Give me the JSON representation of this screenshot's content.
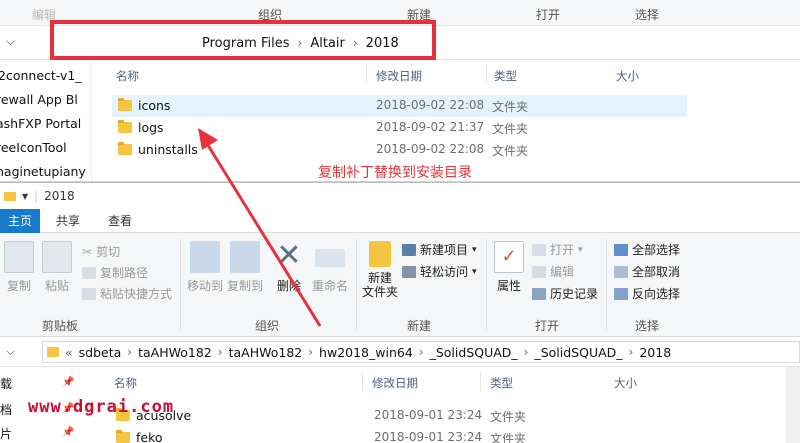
{
  "top_window": {
    "ribbon_labels": [
      "组织",
      "新建",
      "打开",
      "选择"
    ],
    "ribbon_label_partial": "编辑",
    "breadcrumb": [
      "Program Files",
      "Altair",
      "2018"
    ],
    "nav_pane_items": [
      "2connect-v1_",
      "rewall App Bl",
      "ashFXP Portal",
      "reeIconTool",
      "naginetupiany"
    ],
    "columns": {
      "name": "名称",
      "date": "修改日期",
      "type": "类型",
      "size": "大小"
    },
    "rows": [
      {
        "name": "icons",
        "date": "2018-09-02 22:08",
        "type": "文件夹",
        "selected": true
      },
      {
        "name": "logs",
        "date": "2018-09-02 21:37",
        "type": "文件夹",
        "selected": false
      },
      {
        "name": "uninstalls",
        "date": "2018-09-02 22:08",
        "type": "文件夹",
        "selected": false
      }
    ],
    "annotation": "复制补丁替换到安装目录"
  },
  "bottom_window": {
    "title": "2018",
    "tabs": [
      "主页",
      "共享",
      "查看"
    ],
    "ribbon": {
      "clipboard": {
        "copy": "复制",
        "paste": "粘贴",
        "cut": "剪切",
        "copy_path": "复制路径",
        "paste_shortcut": "粘贴快捷方式",
        "label": "剪贴板"
      },
      "organize": {
        "move_to": "移动到",
        "copy_to": "复制到",
        "delete": "删除",
        "rename": "重命名",
        "label": "组织"
      },
      "new": {
        "new_folder": "新建\n文件夹",
        "new_item": "新建项目",
        "easy_access": "轻松访问",
        "label": "新建"
      },
      "open": {
        "properties": "属性",
        "open": "打开",
        "edit": "编辑",
        "history": "历史记录",
        "label": "打开"
      },
      "select": {
        "select_all": "全部选择",
        "select_none": "全部取消",
        "invert": "反向选择",
        "label": "选择"
      }
    },
    "address": [
      "sdbeta",
      "taAHWo182",
      "taAHWo182",
      "hw2018_win64",
      "_SolidSQUAD_",
      "_SolidSQUAD_",
      "2018"
    ],
    "address_prefix": "«",
    "left_items": [
      "载",
      "档",
      "片"
    ],
    "columns": {
      "name": "名称",
      "date": "修改日期",
      "type": "类型",
      "size": "大小"
    },
    "rows": [
      {
        "name": "acusolve",
        "date": "2018-09-01 23:24",
        "type": "文件夹"
      },
      {
        "name": "feko",
        "date": "2018-09-01 23:24",
        "type": "文件夹"
      }
    ]
  },
  "watermark": "www.dgrai.com",
  "colors": {
    "annotation_red": "#e5323c",
    "accent_blue": "#1979ca",
    "selection": "#e5f3ff"
  }
}
